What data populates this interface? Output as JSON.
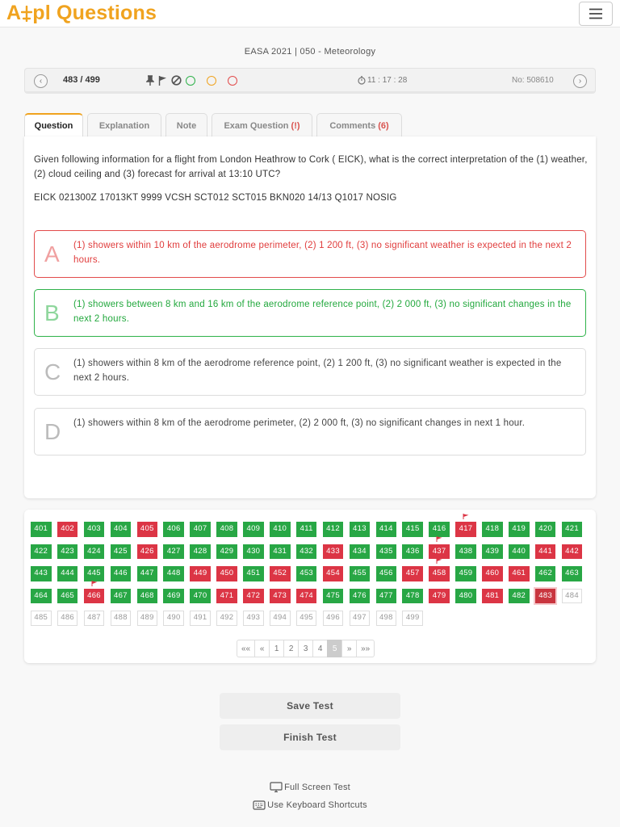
{
  "brand": {
    "logo_prefix": "A",
    "logo_mid": "pl Questions",
    "accent": "#f0a31f"
  },
  "header": {
    "menu_icon": "hamburger-icon"
  },
  "subject": "EASA 2021 | 050 - Meteorology",
  "toolbar": {
    "counter": "483 / 499",
    "timer": "11 : 17 : 28",
    "question_no": "No: 508610",
    "status_circles": [
      {
        "name": "status-circle-green",
        "color": "#2fb24a"
      },
      {
        "name": "status-circle-orange",
        "color": "#f0a31f"
      },
      {
        "name": "status-circle-red",
        "color": "#e24b4b"
      }
    ]
  },
  "tabs": [
    {
      "label": "Question",
      "badge": ""
    },
    {
      "label": "Explanation",
      "badge": ""
    },
    {
      "label": "Note",
      "badge": ""
    },
    {
      "label": "Exam Question",
      "badge": "(!)"
    },
    {
      "label": "Comments",
      "badge": "(6)"
    }
  ],
  "question": {
    "text": "Given following information for a flight from London Heathrow to Cork ( EICK), what is the correct interpretation of the (1) weather, (2) cloud ceiling and (3) forecast for arrival at 13:10 UTC?",
    "metar": "EICK 021300Z 17013KT 9999 VCSH SCT012 SCT015 BKN020 14/13 Q1017 NOSIG"
  },
  "answers": [
    {
      "letter": "A",
      "text": "(1) showers within 10 km of the aerodrome perimeter, (2) 1 200 ft, (3) no significant weather is expected in the next 2 hours.",
      "state": "wrong"
    },
    {
      "letter": "B",
      "text": "(1) showers between 8 km and 16 km of the aerodrome reference point, (2) 2 000 ft, (3) no significant changes in the next 2 hours.",
      "state": "right"
    },
    {
      "letter": "C",
      "text": "(1) showers within 8 km of the aerodrome reference point, (2) 1 200 ft, (3) no significant weather is expected in the next 2 hours.",
      "state": "none"
    },
    {
      "letter": "D",
      "text": "(1) showers within 8 km of the aerodrome perimeter, (2) 2 000 ft, (3) no significant changes in next 1 hour.",
      "state": "none"
    }
  ],
  "grid": {
    "start": 401,
    "end": 499,
    "current": 483,
    "answered_until": 483,
    "wrong": [
      402,
      405,
      417,
      426,
      433,
      437,
      441,
      442,
      449,
      450,
      452,
      454,
      457,
      458,
      460,
      461,
      466,
      471,
      472,
      473,
      474,
      479,
      481,
      483
    ],
    "flagged": [
      417,
      437,
      458,
      466
    ]
  },
  "pager": {
    "items": [
      "««",
      "«",
      "1",
      "2",
      "3",
      "4",
      "5",
      "»",
      "»»"
    ],
    "active": "5"
  },
  "buttons": {
    "save": "Save Test",
    "finish": "Finish Test"
  },
  "footer": {
    "fullscreen": "Full Screen Test",
    "keyboard": "Use Keyboard Shortcuts"
  }
}
